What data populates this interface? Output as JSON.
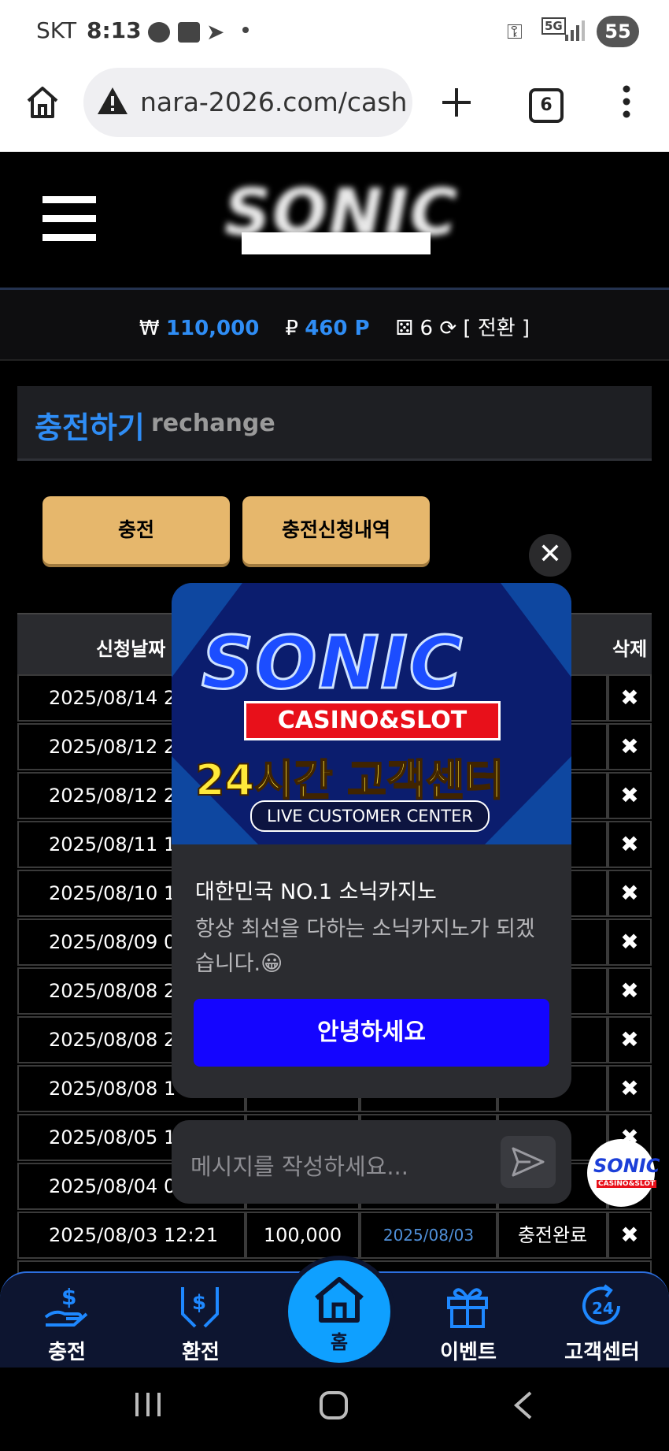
{
  "status_bar": {
    "carrier": "SKT",
    "time": "8:13",
    "battery": "55",
    "network": "5G"
  },
  "browser": {
    "url": "nara-2026.com/cash",
    "tab_count": "6"
  },
  "site": {
    "logo_text": "SONIC"
  },
  "balance": {
    "won_symbol": "₩",
    "won_value": "110,000",
    "point_symbol": "₽",
    "point_value": "460 P",
    "count": "6",
    "switch_label": "[ 전환 ]"
  },
  "page": {
    "title_ko": "충전하기",
    "title_en": "rechange"
  },
  "buttons": {
    "charge": "충전",
    "history": "충전신청내역"
  },
  "table": {
    "headers": {
      "date": "신청날짜",
      "delete": "삭제"
    },
    "rows": [
      {
        "date": "2025/08/14 2",
        "amount": "",
        "done_date": "",
        "status": "료"
      },
      {
        "date": "2025/08/12 2",
        "amount": "",
        "done_date": "",
        "status": "료"
      },
      {
        "date": "2025/08/12 2",
        "amount": "",
        "done_date": "",
        "status": "료"
      },
      {
        "date": "2025/08/11 1",
        "amount": "",
        "done_date": "",
        "status": "료"
      },
      {
        "date": "2025/08/10 1",
        "amount": "",
        "done_date": "",
        "status": "료"
      },
      {
        "date": "2025/08/09 0",
        "amount": "",
        "done_date": "",
        "status": "료"
      },
      {
        "date": "2025/08/08 2",
        "amount": "",
        "done_date": "",
        "status": "료"
      },
      {
        "date": "2025/08/08 2",
        "amount": "",
        "done_date": "",
        "status": "료"
      },
      {
        "date": "2025/08/08 1",
        "amount": "",
        "done_date": "",
        "status": "료"
      },
      {
        "date": "2025/08/05 1",
        "amount": "",
        "done_date": "",
        "status": "료"
      },
      {
        "date": "2025/08/04 0",
        "amount": "",
        "done_date": "",
        "status": "료"
      },
      {
        "date": "2025/08/03 12:21",
        "amount": "100,000",
        "done_date": "2025/08/03",
        "status": "충전완료"
      }
    ],
    "delete_symbol": "✖"
  },
  "popup": {
    "banner_brand": "SONIC",
    "banner_sub": "CASINO&SLOT",
    "banner_hours": "24시간 고객센터",
    "banner_live": "LIVE CUSTOMER CENTER",
    "heading": "대한민국 NO.1 소닉카지노",
    "message": "항상 최선을 다하는 소닉카지노가 되겠습니다.😀",
    "button": "안녕하세요",
    "close_symbol": "✕"
  },
  "chat": {
    "placeholder": "메시지를 작성하세요..."
  },
  "fab": {
    "brand": "SONIC",
    "sub": "CASINO&SLOT"
  },
  "bottom_nav": {
    "items": [
      {
        "label": "충전"
      },
      {
        "label": "환전"
      },
      {
        "label": "홈"
      },
      {
        "label": "이벤트"
      },
      {
        "label": "고객센터"
      }
    ]
  },
  "colors": {
    "accent_blue": "#2f8df5",
    "gold": "#e6b76c",
    "popup_button": "#1405ff",
    "home_button": "#0fa0ff"
  }
}
